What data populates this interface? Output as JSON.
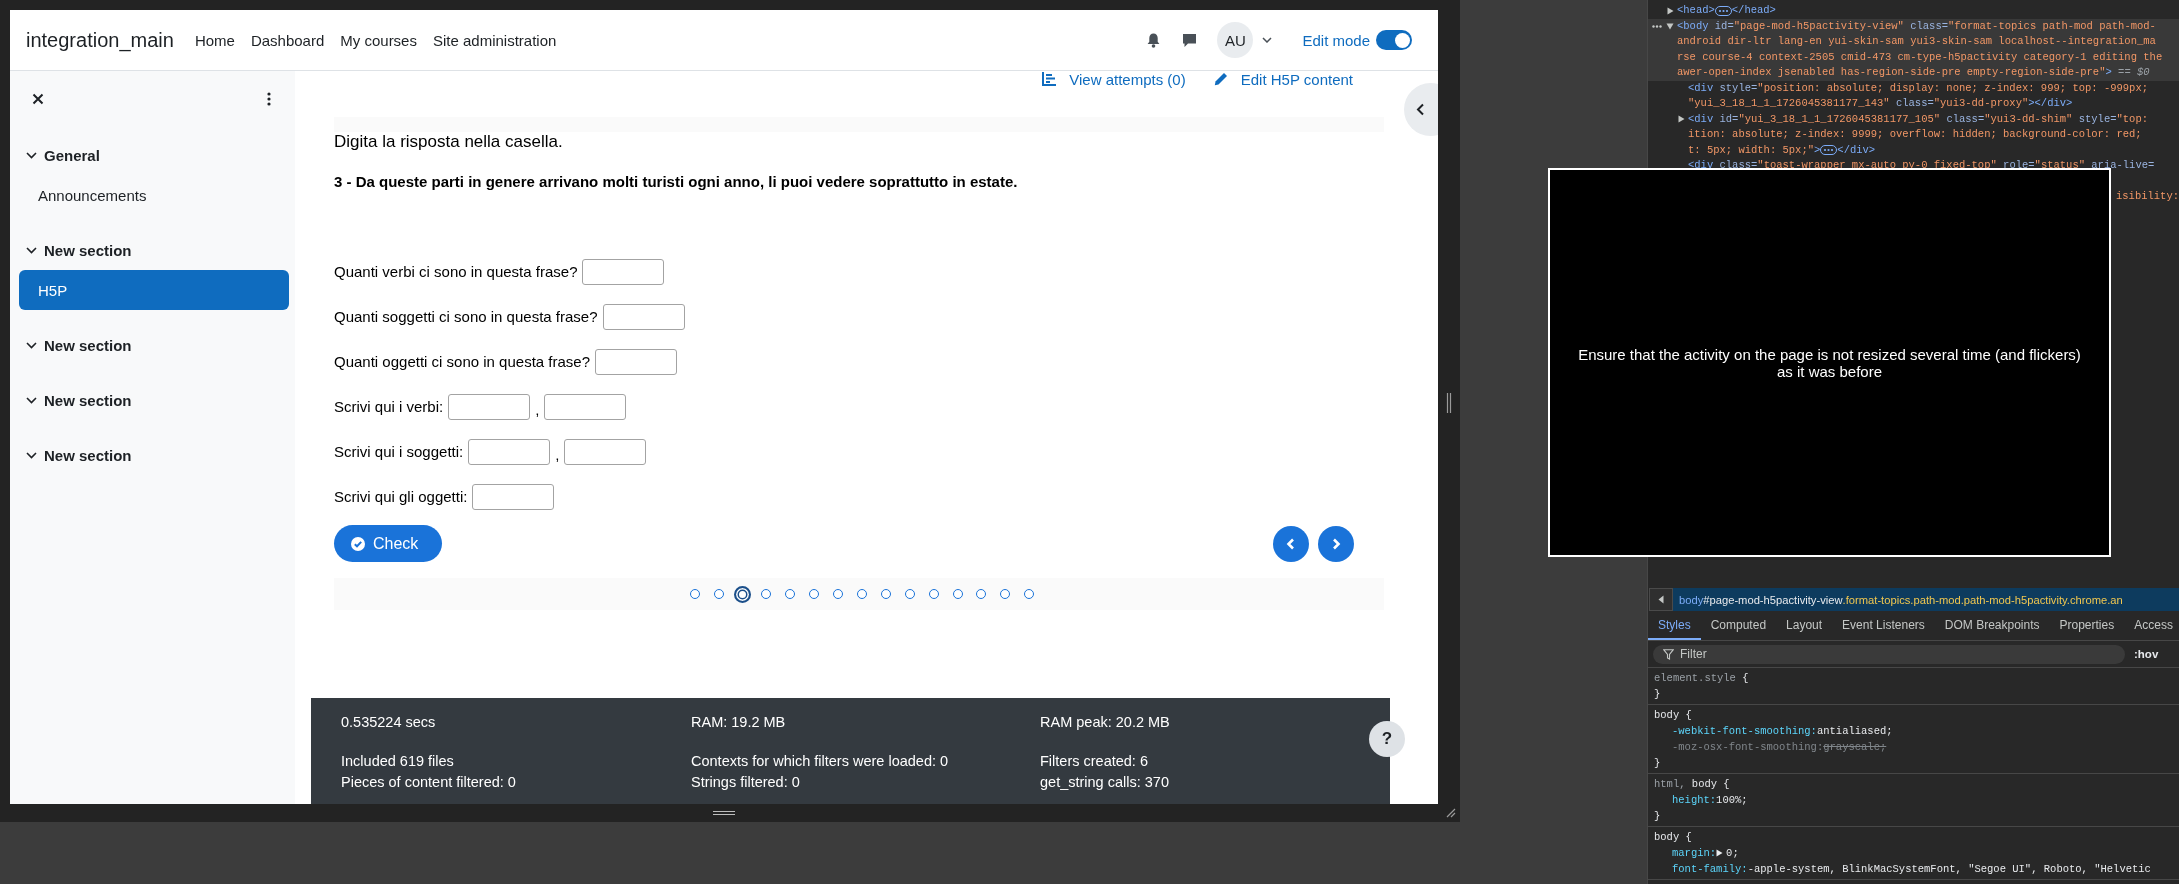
{
  "page": {
    "header": {
      "site_name": "integration_main",
      "nav": [
        {
          "label": "Home"
        },
        {
          "label": "Dashboard"
        },
        {
          "label": "My courses"
        },
        {
          "label": "Site administration"
        }
      ],
      "user_initials": "AU",
      "edit_mode": {
        "label": "Edit mode",
        "on": true
      }
    },
    "drawer": {
      "sections": [
        {
          "label": "General",
          "expanded": true,
          "children": [
            {
              "label": "Announcements",
              "selected": false
            }
          ]
        },
        {
          "label": "New section",
          "expanded": true,
          "children": [
            {
              "label": "H5P",
              "selected": true
            }
          ]
        },
        {
          "label": "New section",
          "expanded": true
        },
        {
          "label": "New section",
          "expanded": true
        },
        {
          "label": "New section",
          "expanded": true
        }
      ]
    },
    "activity_links": [
      {
        "kind": "attempts",
        "label": "View attempts (0)"
      },
      {
        "kind": "edit",
        "label": "Edit H5P content"
      }
    ],
    "h5p": {
      "instruction": "Digita la risposta nella casella.",
      "question": "3 - Da queste parti in genere arrivano molti turisti ogni anno, li puoi vedere soprattutto in estate.",
      "fields": [
        {
          "kind": "single",
          "label": "Quanti verbi ci sono in questa frase?"
        },
        {
          "kind": "single",
          "label": "Quanti soggetti ci sono in questa frase?"
        },
        {
          "kind": "single",
          "label": "Quanti oggetti ci sono in questa frase?"
        },
        {
          "kind": "pair",
          "label": "Scrivi qui i verbi:",
          "separator": ","
        },
        {
          "kind": "pair",
          "label": "Scrivi qui i soggetti:",
          "separator": ","
        },
        {
          "kind": "single",
          "label": "Scrivi qui gli oggetti:"
        }
      ],
      "check_button": "Check",
      "slides": [
        {
          "selected": false
        },
        {
          "selected": false
        },
        {
          "selected": true
        },
        {
          "selected": false
        },
        {
          "selected": false
        },
        {
          "selected": false
        },
        {
          "selected": false
        },
        {
          "selected": false
        },
        {
          "selected": false
        },
        {
          "selected": false
        },
        {
          "selected": false
        },
        {
          "selected": false
        },
        {
          "selected": false
        },
        {
          "selected": false
        },
        {
          "selected": false
        }
      ]
    },
    "footer": {
      "summary": [
        "0.535224 secs",
        "RAM: 19.2 MB",
        "RAM peak: 20.2 MB"
      ],
      "details": [
        "Included 619 files",
        "Contexts for which filters were loaded: 0",
        "Filters created: 6",
        "Pieces of content filtered: 0",
        "Strings filtered: 0",
        "get_string calls: 370"
      ]
    },
    "help_button": "?"
  },
  "overlay": {
    "text": "Ensure that the activity on the page is not resized several time (and flickers) as it was before"
  },
  "devtools": {
    "elements": [
      {
        "expandable": true,
        "expanded": false,
        "selected": false,
        "rows": [
          {
            "parts": [
              {
                "kind": "tag",
                "text": "<head>"
              },
              {
                "kind": "dots"
              },
              {
                "kind": "tag",
                "text": "</head>"
              }
            ]
          }
        ]
      },
      {
        "expandable": true,
        "expanded": true,
        "selected": true,
        "rows": [
          {
            "parts": [
              {
                "kind": "tag",
                "text": "<body"
              },
              {
                "kind": "attr",
                "text": " id="
              },
              {
                "kind": "value",
                "text": "\"page-mod-h5pactivity-view\""
              },
              {
                "kind": "attr",
                "text": " class="
              },
              {
                "kind": "value",
                "text": "\"format-topics path-mod path-mod-"
              }
            ]
          },
          {
            "parts": [
              {
                "kind": "value",
                "text": "android dir-ltr lang-en yui-skin-sam yui3-skin-sam localhost--integration_ma"
              }
            ]
          },
          {
            "parts": [
              {
                "kind": "value",
                "text": "rse course-4 context-2505 cmid-473 cm-type-h5pactivity category-1 editing the"
              }
            ]
          },
          {
            "parts": [
              {
                "kind": "value",
                "text": "awer-open-index jsenabled has-region-side-pre empty-region-side-pre\""
              },
              {
                "kind": "tag",
                "text": ">"
              },
              {
                "kind": "note",
                "text": " == $0"
              }
            ]
          }
        ],
        "children": [
          {
            "expandable": false,
            "selected": false,
            "rows": [
              {
                "parts": [
                  {
                    "kind": "tag",
                    "text": "<div"
                  },
                  {
                    "kind": "attr",
                    "text": " style="
                  },
                  {
                    "kind": "value",
                    "text": "\"position: absolute; display: none; z-index: 999; top: -999px;"
                  }
                ]
              },
              {
                "parts": [
                  {
                    "kind": "value",
                    "text": "\"yui_3_18_1_1_1726045381177_143\""
                  },
                  {
                    "kind": "attr",
                    "text": " class="
                  },
                  {
                    "kind": "value",
                    "text": "\"yui3-dd-proxy\""
                  },
                  {
                    "kind": "tag",
                    "text": "></div>"
                  }
                ]
              }
            ]
          },
          {
            "expandable": true,
            "expanded": false,
            "selected": false,
            "rows": [
              {
                "parts": [
                  {
                    "kind": "tag",
                    "text": "<div"
                  },
                  {
                    "kind": "attr",
                    "text": " id="
                  },
                  {
                    "kind": "value",
                    "text": "\"yui_3_18_1_1_1726045381177_105\""
                  },
                  {
                    "kind": "attr",
                    "text": " class="
                  },
                  {
                    "kind": "value",
                    "text": "\"yui3-dd-shim\""
                  },
                  {
                    "kind": "attr",
                    "text": " style="
                  },
                  {
                    "kind": "value",
                    "text": "\"top:"
                  }
                ]
              },
              {
                "parts": [
                  {
                    "kind": "value",
                    "text": "ition: absolute; z-index: 9999; overflow: hidden; background-color: red;"
                  }
                ]
              },
              {
                "parts": [
                  {
                    "kind": "value",
                    "text": "t: 5px; width: 5px;\""
                  },
                  {
                    "kind": "tag",
                    "text": ">"
                  },
                  {
                    "kind": "dots"
                  },
                  {
                    "kind": "tag",
                    "text": "</div>"
                  }
                ]
              }
            ]
          },
          {
            "expandable": false,
            "selected": false,
            "rows": [
              {
                "parts": [
                  {
                    "kind": "tag",
                    "text": "<div"
                  },
                  {
                    "kind": "attr",
                    "text": " class="
                  },
                  {
                    "kind": "value",
                    "text": "\"toast-wrapper mx-auto py-0 fixed-top\""
                  },
                  {
                    "kind": "attr",
                    "text": " role="
                  },
                  {
                    "kind": "value",
                    "text": "\"status\""
                  },
                  {
                    "kind": "attr",
                    "text": " aria-live="
                  }
                ]
              },
              {
                "parts": [
                  {
                    "kind": "gap"
                  }
                ]
              },
              {
                "parts": [
                  {
                    "kind": "gap"
                  },
                  {
                    "kind": "value",
                    "text": "isibility:"
                  }
                ]
              }
            ]
          }
        ]
      }
    ],
    "breadcrumb": [
      {
        "kind": "tag",
        "text": "body"
      },
      {
        "kind": "id",
        "text": "#page-mod-h5pactivity-view"
      },
      {
        "kind": "class",
        "text": ".format-topics.path-mod.path-mod-h5pactivity.chrome.an"
      }
    ],
    "tabs": [
      {
        "label": "Styles",
        "selected": true
      },
      {
        "label": "Computed",
        "selected": false
      },
      {
        "label": "Layout",
        "selected": false
      },
      {
        "label": "Event Listeners",
        "selected": false
      },
      {
        "label": "DOM Breakpoints",
        "selected": false
      },
      {
        "label": "Properties",
        "selected": false
      },
      {
        "label": "Access",
        "selected": false
      }
    ],
    "filter": {
      "placeholder": "Filter"
    },
    "hov": ":hov",
    "rules": [
      {
        "selector": [
          {
            "text": "element.style",
            "matched": false
          }
        ],
        "open": "{",
        "close": "}"
      },
      {
        "selector": [
          {
            "text": "body",
            "matched": true
          }
        ],
        "open": "{",
        "declarations": [
          {
            "property": "-webkit-font-smoothing:",
            "value": "antialiased;",
            "overridden": false
          },
          {
            "property": "-moz-osx-font-smoothing:",
            "value": "grayscale;",
            "overridden": true
          }
        ],
        "close": "}"
      },
      {
        "selector": [
          {
            "text": "html,",
            "matched": false
          },
          {
            "text": "body",
            "matched": true
          }
        ],
        "open": "{",
        "declarations": [
          {
            "property": "height:",
            "value": "100%;",
            "overridden": false
          }
        ],
        "close": "}"
      },
      {
        "selector": [
          {
            "text": "body",
            "matched": true
          }
        ],
        "open": "{",
        "declarations": [
          {
            "property": "margin:",
            "value": "0;",
            "overridden": false,
            "expandable": true
          },
          {
            "property": "font-family:",
            "value": "-apple-system, BlinkMacSystemFont, \"Segoe UI\", Roboto, \"Helvetic",
            "overridden": false,
            "expandable": false
          }
        ]
      }
    ]
  }
}
